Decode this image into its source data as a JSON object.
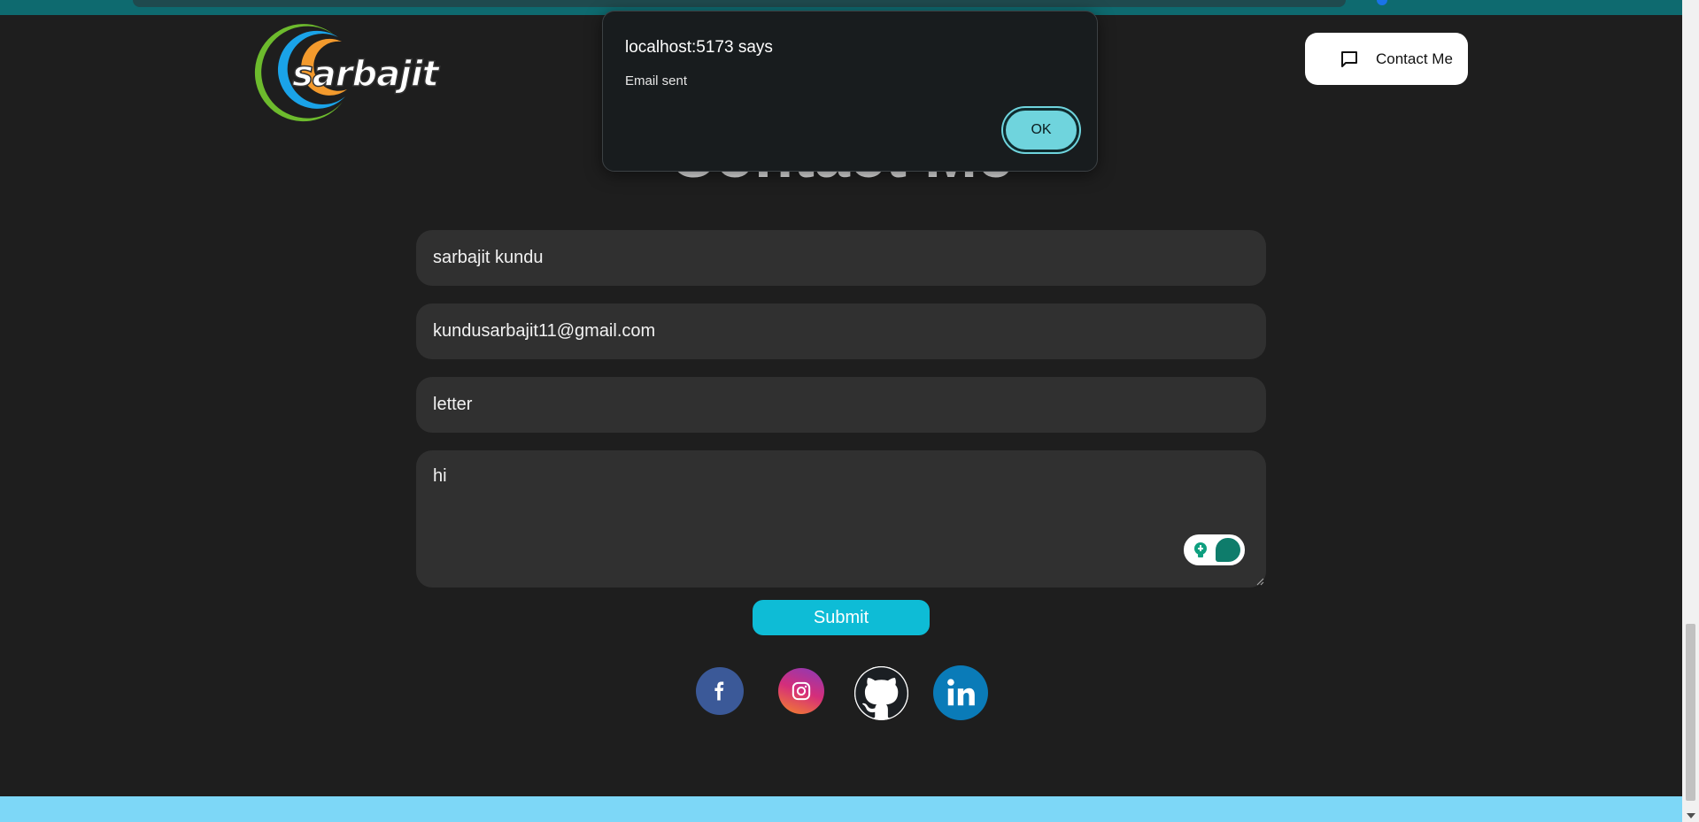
{
  "logo": {
    "text": "sarbajit"
  },
  "header": {
    "contact_button_label": "Contact Me"
  },
  "page": {
    "heading": "Contact Me"
  },
  "form": {
    "name_value": "sarbajit kundu",
    "email_value": "kundusarbajit11@gmail.com",
    "subject_value": "letter",
    "message_value": "hi",
    "submit_label": "Submit"
  },
  "dialog": {
    "title": "localhost:5173 says",
    "message": "Email sent",
    "ok_label": "OK"
  },
  "social": {
    "icons": [
      "facebook-icon",
      "instagram-icon",
      "github-icon",
      "linkedin-icon"
    ]
  },
  "colors": {
    "background": "#1e1e1e",
    "field_bg": "#303030",
    "accent": "#0ebcd6",
    "dialog_button": "#6fd4dd",
    "bottom_bar": "#7dd7f7"
  }
}
